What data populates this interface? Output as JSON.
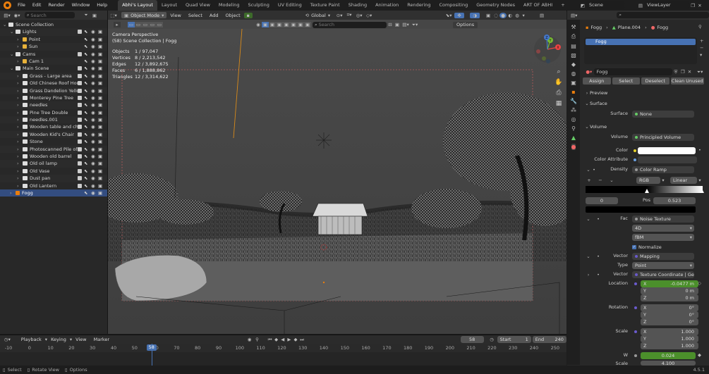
{
  "topbar": {
    "menus": [
      "File",
      "Edit",
      "Render",
      "Window",
      "Help"
    ],
    "workspaces": [
      "Abhi's Layout",
      "Layout",
      "Quad View",
      "Modeling",
      "Sculpting",
      "UV Editing",
      "Texture Paint",
      "Shading",
      "Animation",
      "Rendering",
      "Compositing",
      "Geometry Nodes",
      "ART OF ABHI"
    ],
    "active_workspace": "Abhi's Layout",
    "add_tab": "+",
    "scene": "Scene",
    "view_layer": "ViewLayer"
  },
  "outliner": {
    "search_placeholder": "Search",
    "items": [
      {
        "label": "Scene Collection",
        "depth": 0,
        "kind": "collection"
      },
      {
        "label": "Lights",
        "depth": 1,
        "kind": "collection"
      },
      {
        "label": "Point",
        "depth": 2,
        "kind": "light"
      },
      {
        "label": "Sun",
        "depth": 2,
        "kind": "light"
      },
      {
        "label": "Cams",
        "depth": 1,
        "kind": "collection"
      },
      {
        "label": "Cam 1",
        "depth": 2,
        "kind": "camera"
      },
      {
        "label": "Main Scene",
        "depth": 1,
        "kind": "collection"
      },
      {
        "label": "Grass - Large area",
        "depth": 2,
        "kind": "collection"
      },
      {
        "label": "Old Chinese Roof Hou",
        "depth": 2,
        "kind": "collection"
      },
      {
        "label": "Grass Dandelion Yello",
        "depth": 2,
        "kind": "collection"
      },
      {
        "label": "Monterey Pine Tree",
        "depth": 2,
        "kind": "collection"
      },
      {
        "label": "needles",
        "depth": 2,
        "kind": "collection"
      },
      {
        "label": "Pine Tree Double",
        "depth": 2,
        "kind": "collection"
      },
      {
        "label": "needles.001",
        "depth": 2,
        "kind": "collection"
      },
      {
        "label": "Wooden table and ch",
        "depth": 2,
        "kind": "collection"
      },
      {
        "label": "Wooden Kid's Chair",
        "depth": 2,
        "kind": "collection"
      },
      {
        "label": "Stone",
        "depth": 2,
        "kind": "collection"
      },
      {
        "label": "Photoscanned Pile of",
        "depth": 2,
        "kind": "collection"
      },
      {
        "label": "Wooden old barrel",
        "depth": 2,
        "kind": "collection"
      },
      {
        "label": "Old oil lamp",
        "depth": 2,
        "kind": "collection"
      },
      {
        "label": "Old Vase",
        "depth": 2,
        "kind": "collection"
      },
      {
        "label": "Dust pan",
        "depth": 2,
        "kind": "collection"
      },
      {
        "label": "Old Lantern",
        "depth": 2,
        "kind": "collection"
      },
      {
        "label": "Fogg",
        "depth": 1,
        "kind": "object",
        "selected": true
      }
    ]
  },
  "viewport_header": {
    "mode": "Object Mode",
    "menus": [
      "View",
      "Select",
      "Add",
      "Object"
    ],
    "orientation": "Global",
    "search_placeholder": "Search",
    "options": "Options"
  },
  "viewport": {
    "camera_line1": "Camera Perspective",
    "camera_line2": "(58) Scene Collection | Fogg",
    "stats": [
      {
        "label": "Objects",
        "value": "1 / 97,047"
      },
      {
        "label": "Vertices",
        "value": "8 / 2,213,542"
      },
      {
        "label": "Edges",
        "value": "12 / 3,892,675"
      },
      {
        "label": "Faces",
        "value": "6 / 1,888,862"
      },
      {
        "label": "Triangles",
        "value": "12 / 3,314,622"
      }
    ],
    "gizmo": {
      "x": "X",
      "y": "Y",
      "z": "Z"
    }
  },
  "properties": {
    "search_placeholder": "",
    "breadcrumb": [
      "Fogg",
      "Plane.004",
      "Fogg"
    ],
    "material_slot": "Fogg",
    "material_name": "Fogg",
    "buttons": {
      "assign": "Assign",
      "select": "Select",
      "deselect": "Deselect",
      "clean": "Clean Unused"
    },
    "sections": {
      "preview": "Preview",
      "surface": "Surface",
      "volume": "Volume"
    },
    "surface": {
      "label": "Surface",
      "value": "None"
    },
    "volume": {
      "label": "Volume",
      "value": "Principled Volume"
    },
    "color": {
      "label": "Color",
      "hex": "#ffffff"
    },
    "color_attribute": {
      "label": "Color Attribute",
      "value": ""
    },
    "density": {
      "label": "Density",
      "value": "Color Ramp"
    },
    "ramp": {
      "mode": "RGB",
      "interp": "Linear",
      "index": "0",
      "pos_label": "Pos",
      "pos": "0.523"
    },
    "fac": {
      "label": "Fac",
      "value": "Noise Texture",
      "dim": "4D",
      "type": "fBM",
      "normalize": "Normalize"
    },
    "vector": {
      "label": "Vector",
      "value": "Mapping",
      "type_label": "Type",
      "type": "Point"
    },
    "vector2": {
      "label": "Vector",
      "value": "Texture Coordinate | Gener..."
    },
    "location": {
      "label": "Location",
      "x": "-0.0477 m",
      "y": "0 m",
      "z": "0 m"
    },
    "rotation": {
      "label": "Rotation",
      "x": "0°",
      "y": "0°",
      "z": "0°"
    },
    "scale": {
      "label": "Scale",
      "x": "1.000",
      "y": "1.000",
      "z": "1.000"
    },
    "w": {
      "label": "W",
      "value": "0.024"
    },
    "scale2": {
      "label": "Scale",
      "value": "4.100"
    },
    "axes": {
      "x": "X",
      "y": "Y",
      "z": "Z"
    }
  },
  "timeline": {
    "menus": [
      "Playback",
      "Keying",
      "View",
      "Marker"
    ],
    "current_frame": "58",
    "start_label": "Start",
    "start": "1",
    "end_label": "End",
    "end": "240",
    "ticks": [
      "-10",
      "0",
      "10",
      "20",
      "30",
      "40",
      "50",
      "60",
      "70",
      "80",
      "90",
      "100",
      "110",
      "120",
      "130",
      "140",
      "150",
      "160",
      "170",
      "180",
      "190",
      "200",
      "210",
      "220",
      "230",
      "240",
      "250"
    ]
  },
  "statusbar": {
    "select": "Select",
    "rotate": "Rotate View",
    "options": "Options",
    "version": "4.5.1"
  },
  "colors": {
    "accent_blue": "#4772b3",
    "selection": "#334d80",
    "blender_orange": "#e87d0d",
    "green_field": "#4b8f2b",
    "playhead": "#4772b3"
  }
}
